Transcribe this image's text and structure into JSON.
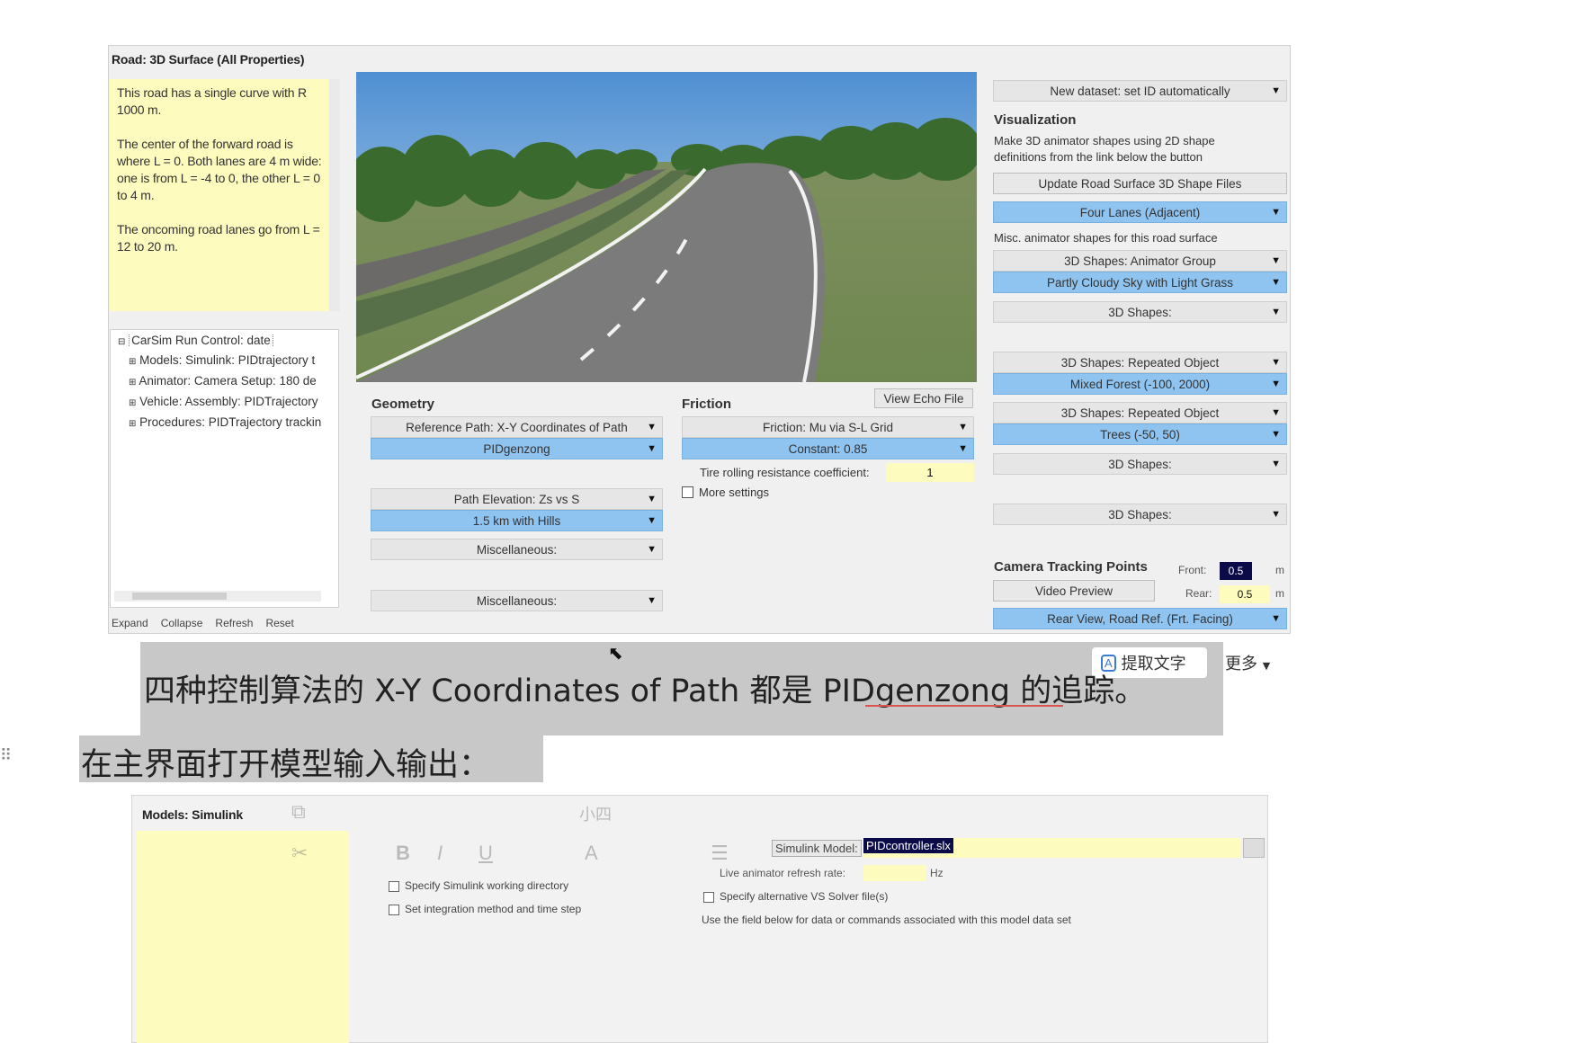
{
  "screenshot1": {
    "panel_title": "Road: 3D Surface (All Properties)",
    "notes": [
      "This road has a single curve with R 1000 m.",
      "The center of the forward road is where L = 0. Both lanes are 4 m wide: one is from L = -4 to 0, the other L = 0 to 4 m.",
      "The oncoming road lanes go from L = 12 to 20 m."
    ],
    "tree": [
      "CarSim Run Control: date",
      "Models: Simulink: PIDtrajectory t",
      "Animator: Camera Setup: 180 de",
      "Vehicle: Assembly: PIDTrajectory",
      "Procedures: PIDTrajectory trackin"
    ],
    "tree_buttons": [
      "Expand",
      "Collapse",
      "Refresh",
      "Reset"
    ],
    "geometry": {
      "title": "Geometry",
      "ref_path": "Reference Path: X-Y Coordinates of Path",
      "ref_path_value": "PIDgenzong",
      "path_elev": "Path Elevation: Zs vs S",
      "path_elev_value": "1.5 km with Hills",
      "misc1": "Miscellaneous:",
      "misc2": "Miscellaneous:"
    },
    "friction": {
      "title": "Friction",
      "view_echo": "View Echo File",
      "mu": "Friction: Mu via S-L Grid",
      "mu_value": "Constant: 0.85",
      "rolling_label": "Tire rolling resistance coefficient:",
      "rolling_value": "1",
      "more_settings": "More settings"
    },
    "right": {
      "dataset": "New dataset: set ID automatically",
      "viz_title": "Visualization",
      "viz_desc": "Make 3D animator shapes using 2D shape definitions from the link below the button",
      "update_btn": "Update Road Surface 3D Shape Files",
      "four_lanes": "Four Lanes (Adjacent)",
      "misc_desc": "Misc. animator shapes for this road surface",
      "shapes_group": "3D Shapes: Animator Group",
      "sky": "Partly Cloudy Sky with Light Grass",
      "shapes_a": "3D Shapes:",
      "repeated1": "3D Shapes: Repeated Object",
      "forest": "Mixed Forest (-100, 2000)",
      "repeated2": "3D Shapes: Repeated Object",
      "trees": "Trees (-50, 50)",
      "shapes_b": "3D Shapes:",
      "shapes_c": "3D Shapes:",
      "cam_title": "Camera Tracking Points",
      "front_label": "Front:",
      "front_value": "0.5",
      "rear_label": "Rear:",
      "rear_value": "0.5",
      "unit": "m",
      "video_btn": "Video Preview",
      "rear_view": "Rear View, Road Ref. (Frt. Facing)"
    }
  },
  "doc": {
    "line1": "四种控制算法的 X-Y Coordinates of Path 都是 PIDgenzong 的追踪。",
    "line2": "在主界面打开模型输入输出：",
    "ocr_button": "提取文字",
    "more_button": "更多"
  },
  "screenshot2": {
    "panel_title": "Models: Simulink",
    "model_label": "Simulink Model:",
    "model_value": "PIDcontroller.slx",
    "refresh_label": "Live animator refresh rate:",
    "refresh_unit": "Hz",
    "specify_dir": "Specify Simulink working directory",
    "specify_solver": "Specify alternative VS Solver file(s)",
    "integration": "Set integration method and time step",
    "use_field": "Use the field below  for data or commands associated with this model data set",
    "overlay_font": "小四"
  },
  "colors": {
    "accent_blue": "#8fc3f0",
    "note_yellow": "#fdfbbe",
    "highlight_grey": "#c8c8c8"
  }
}
